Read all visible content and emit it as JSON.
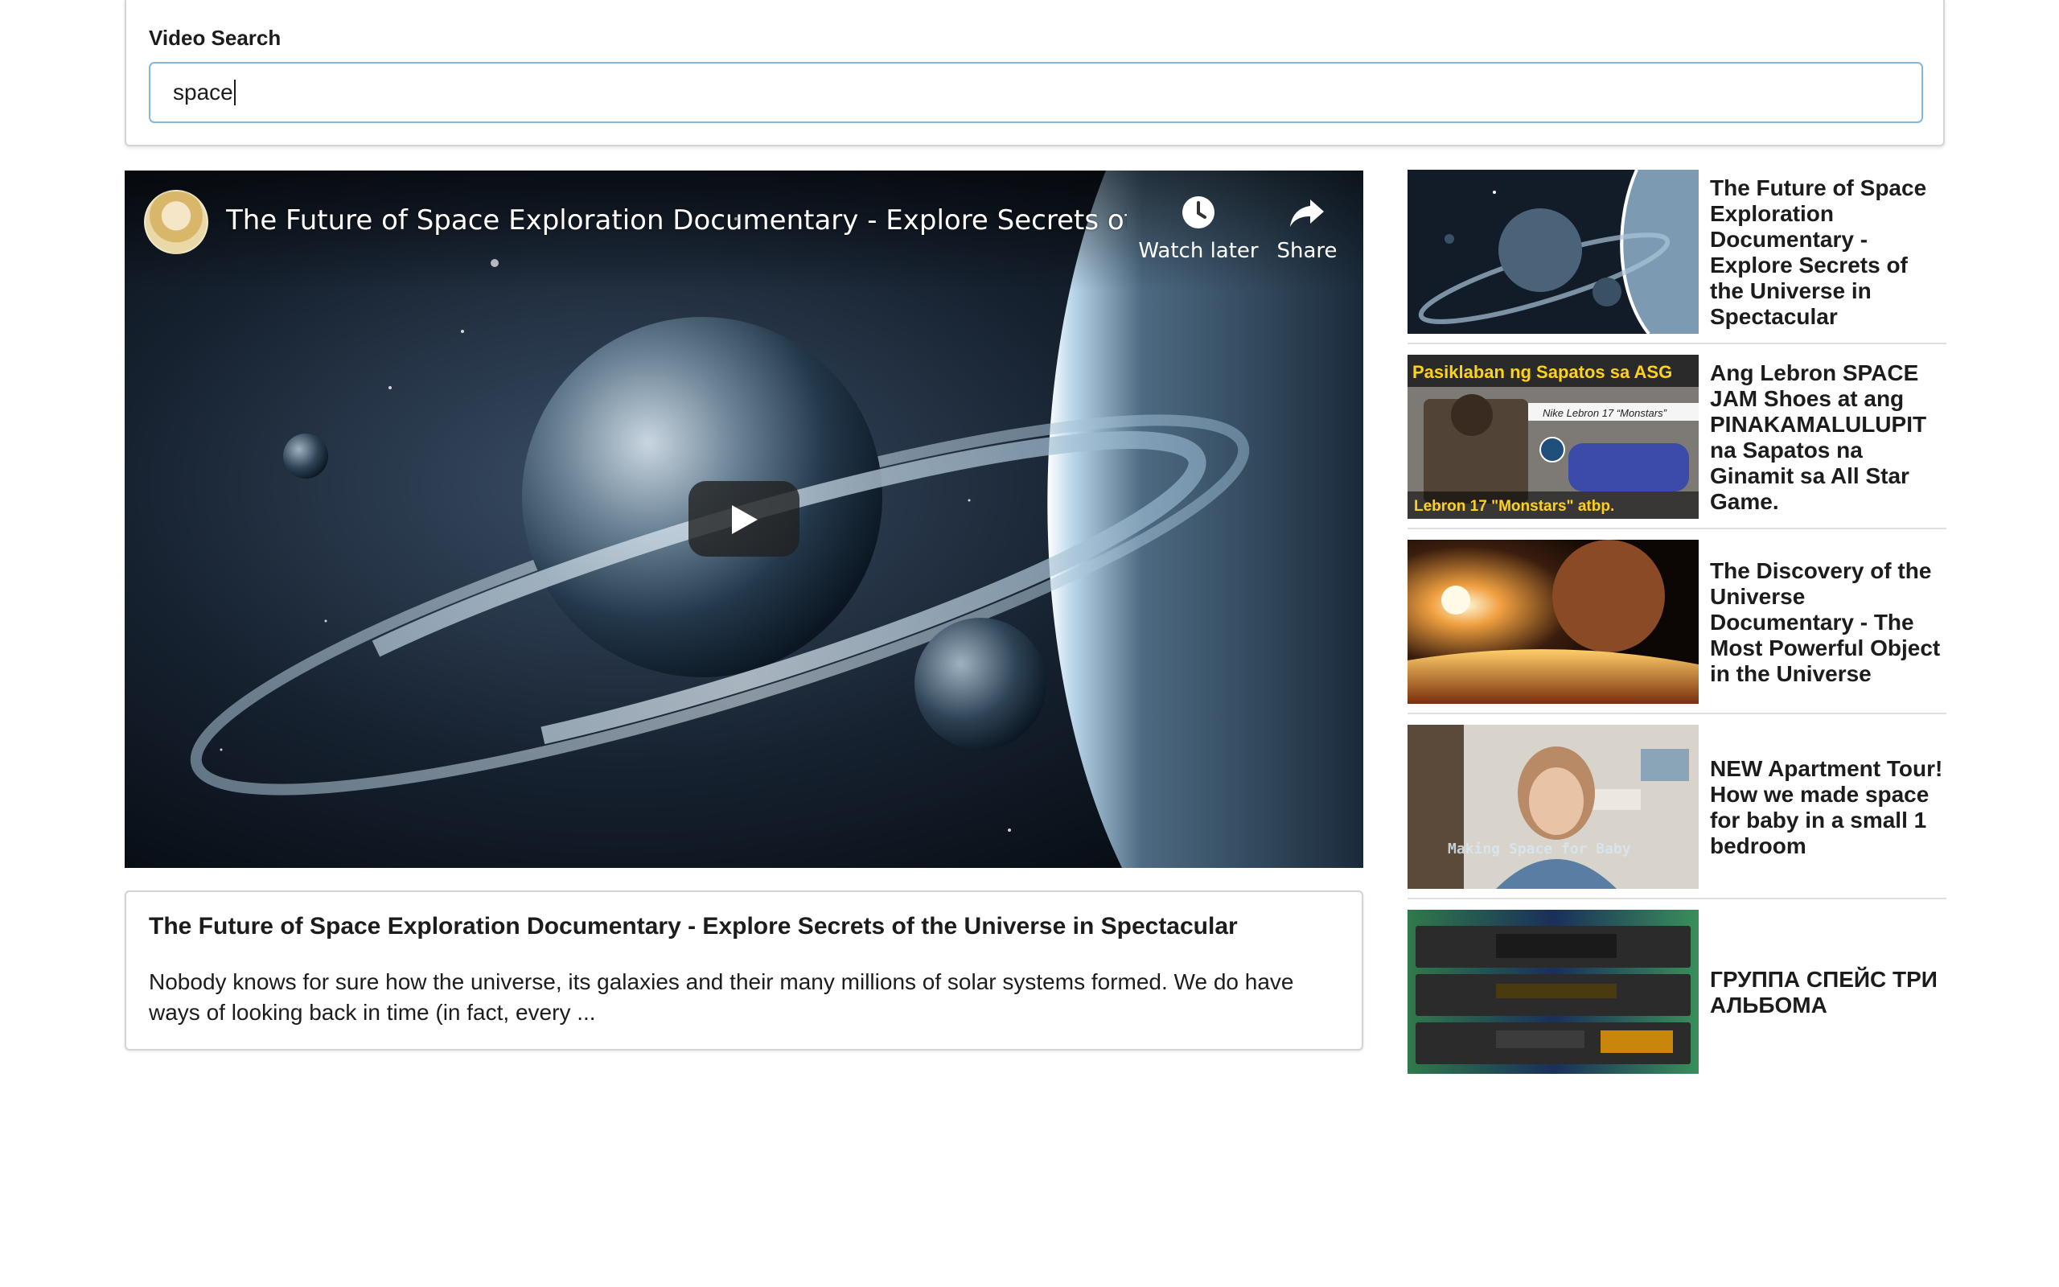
{
  "search": {
    "label": "Video Search",
    "value": "space"
  },
  "player": {
    "title": "The Future of Space Exploration Documentary - Explore Secrets of ...",
    "watch_later_label": "Watch later",
    "share_label": "Share",
    "icons": [
      "clock-icon",
      "share-arrow-icon",
      "play-icon"
    ]
  },
  "selected_video": {
    "title": "The Future of Space Exploration Documentary - Explore Secrets of the Universe in Spectacular",
    "description": "Nobody knows for sure how the universe, its galaxies and their many millions of solar systems formed. We do have ways of looking back in time (in fact, every ..."
  },
  "video_list": {
    "items": [
      {
        "title": "The Future of Space Exploration Documentary - Explore Secrets of the Universe in Spectacular"
      },
      {
        "title": "Ang Lebron SPACE JAM Shoes at ang PINAKAMALULUPIT na Sapatos na Ginamit sa All Star Game.",
        "thumb_top_text": "Pasiklaban ng Sapatos sa ASG",
        "thumb_tag_text": "Nike Lebron 17 “Monstars”",
        "thumb_bottom_text": "Lebron 17 \"Monstars\" atbp."
      },
      {
        "title": "The Discovery of the Universe Documentary - The Most Powerful Object in the Universe"
      },
      {
        "title": "NEW Apartment Tour! How we made space for baby in a small 1 bedroom",
        "thumb_caption": "Making Space for Baby"
      },
      {
        "title": "ГРУППА СПЕЙС ТРИ АЛЬБОМА"
      }
    ]
  },
  "colors": {
    "input_focus_border": "#85b7d9",
    "card_border": "#d4d4d5",
    "text": "#1b1c1d"
  }
}
